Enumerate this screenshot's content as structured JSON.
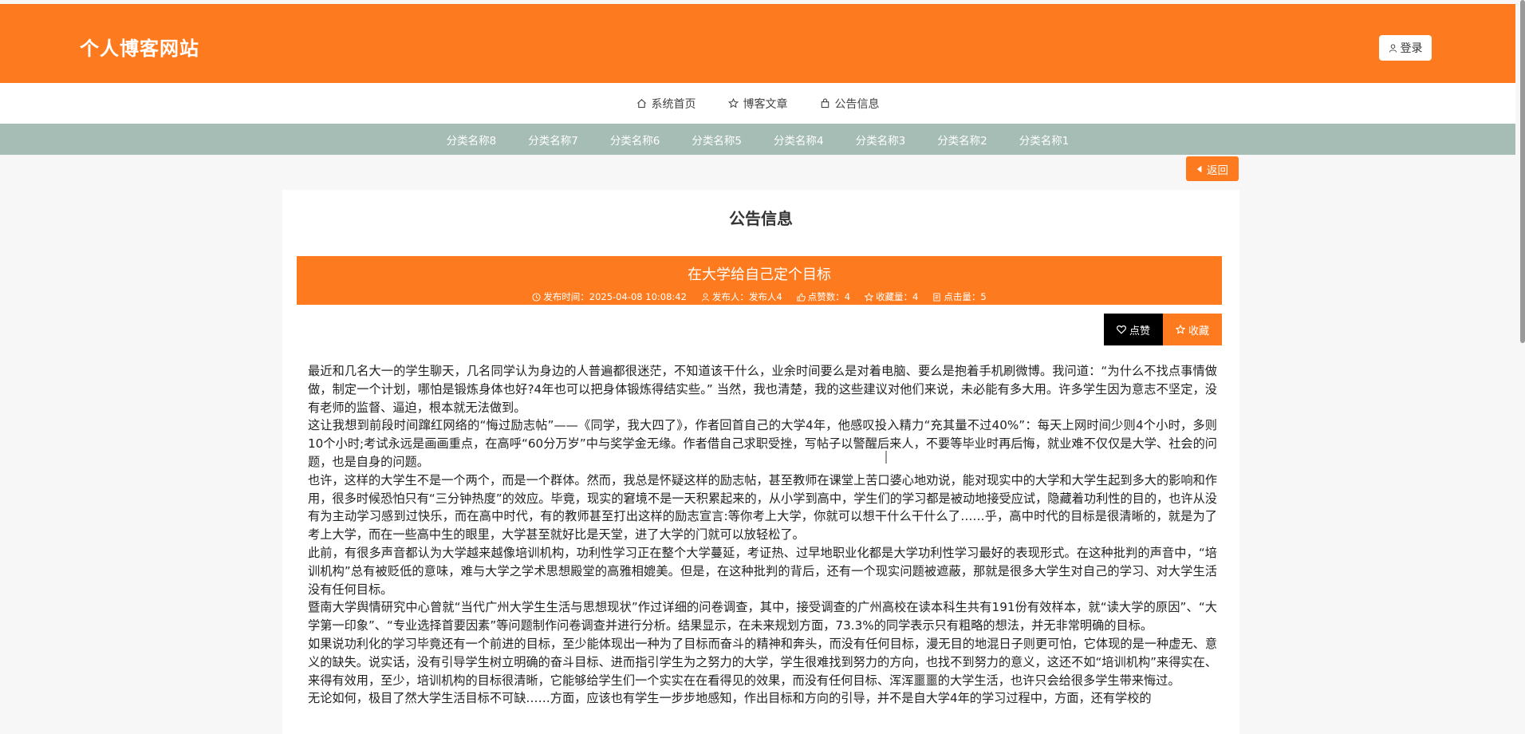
{
  "header": {
    "site_title": "个人博客网站",
    "login_label": "登录"
  },
  "nav": {
    "items": [
      {
        "label": "系统首页",
        "icon": "home-icon"
      },
      {
        "label": "博客文章",
        "icon": "star-icon"
      },
      {
        "label": "公告信息",
        "icon": "bag-icon"
      }
    ]
  },
  "categories": [
    "分类名称8",
    "分类名称7",
    "分类名称6",
    "分类名称5",
    "分类名称4",
    "分类名称3",
    "分类名称2",
    "分类名称1"
  ],
  "back_label": "返回",
  "page_title": "公告信息",
  "notice": {
    "title": "在大学给自己定个目标",
    "publish_time": "发布时间：2025-04-08 10:08:42",
    "publisher": "发布人：发布人4",
    "likes": "点赞数：4",
    "favorites": "收藏量：4",
    "clicks": "点击量：5"
  },
  "actions": {
    "like_label": "点赞",
    "fav_label": "收藏"
  },
  "article": {
    "paragraphs": [
      "  最近和几名大一的学生聊天，几名同学认为身边的人普遍都很迷茫，不知道该干什么，业余时间要么是对着电脑、要么是抱着手机刷微博。我问道：“为什么不找点事情做做，制定一个计划，哪怕是锻炼身体也好?4年也可以把身体锻炼得结实些。” 当然，我也清楚，我的这些建议对他们来说，未必能有多大用。许多学生因为意志不坚定，没有老师的监督、逼迫，根本就无法做到。",
      "   这让我想到前段时间蹿红网络的“悔过励志帖”——《同学，我大四了》，作者回首自己的大学4年，他感叹投入精力“充其量不过40%”：每天上网时间少则4个小时，多则10个小时;考试永远是画画重点，在高呼“60分万岁”中与奖学金无缘。作者借自己求职受挫，写帖子以警醒后来人，不要等毕业时再后悔，就业难不仅仅是大学、社会的问题，也是自身的问题。",
      "  也许，这样的大学生不是一个两个，而是一个群体。然而，我总是怀疑这样的励志帖，甚至教师在课堂上苦口婆心地劝说，能对现实中的大学和大学生起到多大的影响和作用，很多时候恐怕只有“三分钟热度”的效应。毕竟，现实的窘境不是一天积累起来的，从小学到高中，学生们的学习都是被动地接受应试，隐藏着功利性的目的，也许从没有为主动学习感到过快乐，而在高中时代，有的教师甚至打出这样的励志宣言:等你考上大学，你就可以想干什么干什么了……乎，高中时代的目标是很清晰的，就是为了考上大学，而在一些高中生的眼里，大学甚至就好比是天堂，进了大学的门就可以放轻松了。",
      " 此前，有很多声音都认为大学越来越像培训机构，功利性学习正在整个大学蔓延，考证热、过早地职业化都是大学功利性学习最好的表现形式。在这种批判的声音中，“培训机构”总有被贬低的意味，难与大学之学术思想殿堂的高雅相媲美。但是，在这种批判的背后，还有一个现实问题被遮蔽，那就是很多大学生对自己的学习、对大学生活没有任何目标。",
      "暨南大学舆情研究中心曾就“当代广州大学生生活与思想现状”作过详细的问卷调查，其中，接受调查的广州高校在读本科生共有191份有效样本，就“读大学的原因”、“大学第一印象”、“专业选择首要因素”等问题制作问卷调查并进行分析。结果显示，在未来规划方面，73.3%的同学表示只有粗略的想法，并无非常明确的目标。",
      "  如果说功利化的学习毕竟还有一个前进的目标，至少能体现出一种为了目标而奋斗的精神和奔头，而没有任何目标，漫无目的地混日子则更可怕，它体现的是一种虚无、意义的缺失。说实话，没有引导学生树立明确的奋斗目标、进而指引学生为之努力的大学，学生很难找到努力的方向，也找不到努力的意义，这还不如“培训机构”来得实在、来得有效用，至少，培训机构的目标很清晰，它能够给学生们一个实实在在看得见的效果，而没有任何目标、浑浑噩噩的大学生活，也许只会给很多学生带来悔过。",
      "无论如何，极目了然大学生活目标不可缺……方面，应该也有学生一步步地感知，作出目标和方向的引导，并不是自大学4年的学习过程中，方面，还有学校的"
    ]
  },
  "colors": {
    "brand": "#fd7b1e",
    "category_bar": "#a6bdb6",
    "like_button": "#000000"
  }
}
